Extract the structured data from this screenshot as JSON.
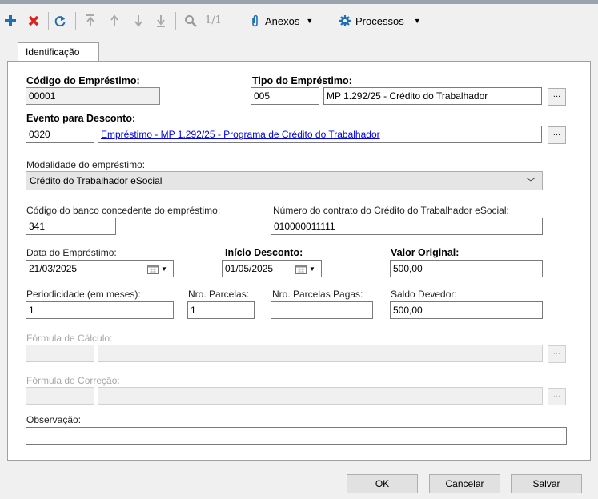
{
  "toolbar": {
    "add_icon": "plus-icon",
    "delete_icon": "x-icon",
    "refresh_icon": "refresh-icon",
    "pager": "1/1",
    "anexos_label": "Anexos",
    "processos_label": "Processos"
  },
  "tabs": [
    "Identificação"
  ],
  "form": {
    "codigo_label": "Código do Empréstimo:",
    "codigo_value": "00001",
    "tipo_label": "Tipo do Empréstimo:",
    "tipo_code": "005",
    "tipo_desc": "MP 1.292/25 - Crédito do Trabalhador",
    "evento_label": "Evento para Desconto:",
    "evento_code": "0320",
    "evento_desc": "Empréstimo - MP 1.292/25 - Programa de Crédito do Trabalhador",
    "modalidade_label": "Modalidade do empréstimo:",
    "modalidade_value": "Crédito do Trabalhador eSocial",
    "banco_label": "Código do banco concedente do empréstimo:",
    "banco_value": "341",
    "contrato_label": "Número do contrato do Crédito do Trabalhador eSocial:",
    "contrato_value": "010000011111",
    "data_label": "Data do Empréstimo:",
    "data_value": "21/03/2025",
    "inicio_label": "Início Desconto:",
    "inicio_value": "01/05/2025",
    "valor_label": "Valor Original:",
    "valor_value": "500,00",
    "periodicidade_label": "Periodicidade (em meses):",
    "periodicidade_value": "1",
    "parcelas_label": "Nro. Parcelas:",
    "parcelas_value": "1",
    "pagas_label": "Nro. Parcelas Pagas:",
    "pagas_value": "",
    "saldo_label": "Saldo Devedor:",
    "saldo_value": "500,00",
    "formula_calc_label": "Fórmula de Cálculo:",
    "formula_corr_label": "Fórmula de Correção:",
    "observacao_label": "Observação:",
    "observacao_value": "",
    "ellipsis": "..."
  },
  "buttons": {
    "ok": "OK",
    "cancelar": "Cancelar",
    "salvar": "Salvar"
  }
}
